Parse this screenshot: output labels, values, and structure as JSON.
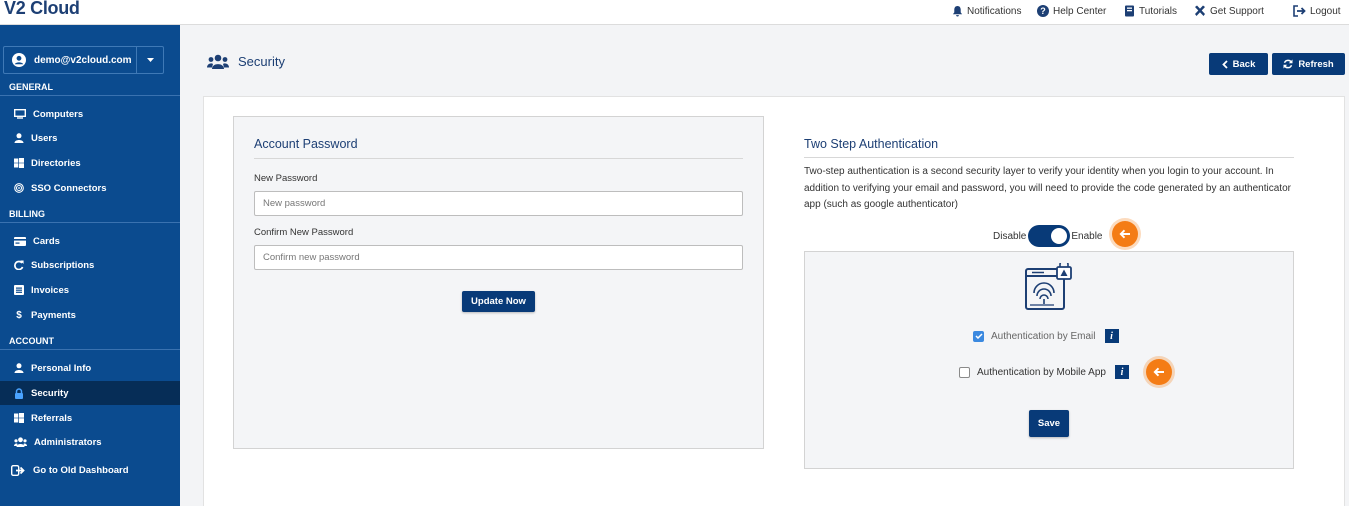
{
  "app": {
    "logo": "V2 Cloud"
  },
  "topnav": [
    {
      "label": "Notifications",
      "icon": "bell-icon"
    },
    {
      "label": "Help Center",
      "icon": "question-icon"
    },
    {
      "label": "Tutorials",
      "icon": "book-icon"
    },
    {
      "label": "Get Support",
      "icon": "tools-icon"
    },
    {
      "label": "Logout",
      "icon": "logout-icon"
    }
  ],
  "sidebar": {
    "account": "demo@v2cloud.com",
    "sections": {
      "general": "GENERAL",
      "billing": "BILLING",
      "account": "ACCOUNT"
    },
    "items": [
      {
        "label": "Computers",
        "icon": "monitor-icon"
      },
      {
        "label": "Users",
        "icon": "user-icon"
      },
      {
        "label": "Directories",
        "icon": "windows-icon"
      },
      {
        "label": "SSO Connectors",
        "icon": "fingerprint-icon"
      },
      {
        "label": "Cards",
        "icon": "credit-card-icon"
      },
      {
        "label": "Subscriptions",
        "icon": "redo-icon"
      },
      {
        "label": "Invoices",
        "icon": "invoice-icon"
      },
      {
        "label": "Payments",
        "icon": "dollar-icon"
      },
      {
        "label": "Personal Info",
        "icon": "user-icon"
      },
      {
        "label": "Security",
        "icon": "lock-icon",
        "active": true
      },
      {
        "label": "Referrals",
        "icon": "windows-icon"
      },
      {
        "label": "Administrators",
        "icon": "users-icon"
      },
      {
        "label": "Go to Old Dashboard",
        "icon": "sign-out-icon"
      }
    ]
  },
  "header": {
    "title": "Security",
    "back": "Back",
    "refresh": "Refresh"
  },
  "password": {
    "title": "Account Password",
    "new_label": "New Password",
    "new_placeholder": "New password",
    "confirm_label": "Confirm New Password",
    "confirm_placeholder": "Confirm new password",
    "submit": "Update Now"
  },
  "two_step": {
    "title": "Two Step Authentication",
    "description": "Two-step authentication is a second security layer to verify your identity when you login to your account. In addition to verifying your email and password, you will need to provide the code generated by an authenticator app (such as google authenticator)",
    "disable_label": "Disable",
    "enable_label": "Enable",
    "enabled": true,
    "email_option": "Authentication by Email",
    "email_checked": true,
    "mobile_option": "Authentication by Mobile App",
    "mobile_checked": false,
    "save": "Save"
  },
  "colors": {
    "sidebar": "#0b4b8f",
    "primary_button": "#083a78",
    "callout": "#f47c15"
  }
}
